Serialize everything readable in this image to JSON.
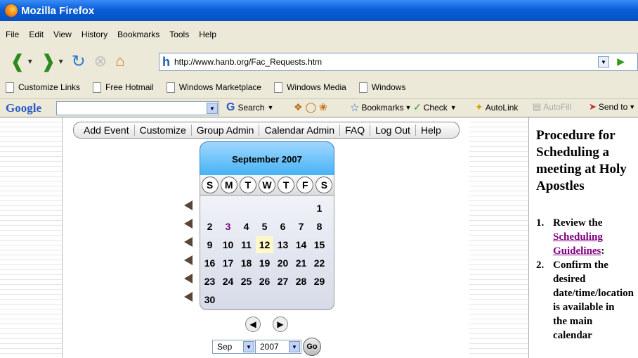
{
  "window": {
    "title": "Mozilla Firefox"
  },
  "menu": [
    "File",
    "Edit",
    "View",
    "History",
    "Bookmarks",
    "Tools",
    "Help"
  ],
  "nav": {
    "url": "http://www.hanb.org/Fac_Requests.htm"
  },
  "bookmarks": [
    "Customize Links",
    "Free Hotmail",
    "Windows Marketplace",
    "Windows Media",
    "Windows"
  ],
  "googlebar": {
    "logo": "Google",
    "search": "Search",
    "bookmarks": "Bookmarks",
    "check": "Check",
    "autolink": "AutoLink",
    "autofill": "AutoFill",
    "sendto": "Send to"
  },
  "topnav": [
    "Add Event",
    "Customize",
    "Group Admin",
    "Calendar Admin",
    "FAQ",
    "Log Out",
    "Help"
  ],
  "calendar": {
    "month_label": "September 2007",
    "weekdays": [
      "S",
      "M",
      "T",
      "W",
      "T",
      "F",
      "S"
    ],
    "weeks": [
      [
        "",
        "",
        "",
        "",
        "",
        "",
        "1"
      ],
      [
        "2",
        "3",
        "4",
        "5",
        "6",
        "7",
        "8"
      ],
      [
        "9",
        "10",
        "11",
        "12",
        "13",
        "14",
        "15"
      ],
      [
        "16",
        "17",
        "18",
        "19",
        "20",
        "21",
        "22"
      ],
      [
        "23",
        "24",
        "25",
        "26",
        "27",
        "28",
        "29"
      ],
      [
        "30",
        "",
        "",
        "",
        "",
        "",
        ""
      ]
    ],
    "month_select": "Sep",
    "year_select": "2007",
    "go_label": "Go"
  },
  "panel": {
    "title": "Procedure for Scheduling a meeting at Holy Apostles",
    "items": [
      {
        "num": "1.",
        "lines": [
          "Review the"
        ],
        "link_lines": [
          "Scheduling",
          "Guidelines"
        ],
        "after_link": ":"
      },
      {
        "num": "2.",
        "lines": [
          "Confirm the",
          "desired",
          "date/time/location",
          "is available in",
          "the main",
          "calendar"
        ]
      }
    ]
  }
}
